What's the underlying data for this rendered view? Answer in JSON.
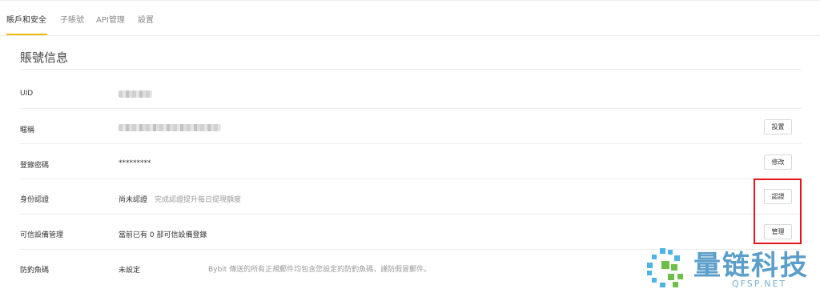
{
  "tabs": [
    {
      "label": "賬戶和安全",
      "active": true
    },
    {
      "label": "子賬號",
      "active": false
    },
    {
      "label": "API管理",
      "active": false
    },
    {
      "label": "設置",
      "active": false
    }
  ],
  "section": {
    "title": "賬號信息"
  },
  "rows": [
    {
      "label": "UID",
      "value": "",
      "hint": "",
      "note": "",
      "button": ""
    },
    {
      "label": "暱稱",
      "value": "",
      "hint": "",
      "note": "",
      "button": "設置"
    },
    {
      "label": "登錄密碼",
      "value": "*********",
      "hint": "",
      "note": "",
      "button": "修改"
    },
    {
      "label": "身份認證",
      "value": "尚未認證",
      "hint": "完成認證提升每日提現額度",
      "note": "",
      "button": "認證"
    },
    {
      "label": "可信設備管理",
      "value": "當前已有 0 部可信設備登錄",
      "hint": "",
      "note": "",
      "button": "管理"
    },
    {
      "label": "防釣魚碼",
      "value": "未設定",
      "hint": "",
      "note": "Bybit 傳送的所有正規郵件均包含您設定的防釣魚碼，謹防假冒郵件。",
      "button": ""
    }
  ],
  "watermark": {
    "text": "量链科技",
    "sub": "QFSP.NET"
  },
  "colors": {
    "accent": "#f0b90b",
    "highlight": "#e8141b",
    "watermark": "#5b9ec9"
  }
}
